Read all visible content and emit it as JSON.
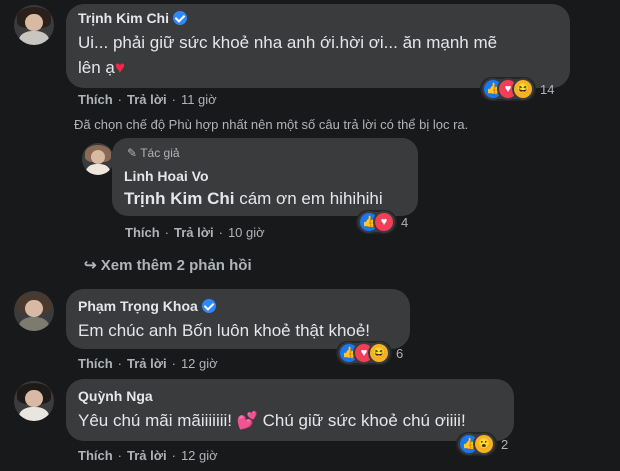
{
  "comments": [
    {
      "name": "Trịnh Kim Chi",
      "verified": true,
      "text_line1": "Ui... phải giữ sức khoẻ nha anh ới.hời ơi... ăn mạnh mẽ",
      "text_line2": "lên ạ",
      "text_emoji": "♥",
      "like_label": "Thích",
      "reply_label": "Trả lời",
      "time": "11 giờ",
      "reaction_icons": [
        "like-icon",
        "love-icon",
        "haha-icon"
      ],
      "reaction_count": "14"
    },
    {
      "name": "Phạm Trọng Khoa",
      "verified": true,
      "text_line1": "Em chúc anh Bốn luôn khoẻ thật khoẻ!",
      "like_label": "Thích",
      "reply_label": "Trả lời",
      "time": "12 giờ",
      "reaction_icons": [
        "like-icon",
        "love-icon",
        "haha-icon"
      ],
      "reaction_count": "6"
    },
    {
      "name": "Quỳnh Nga",
      "verified": false,
      "text_before": "Yêu chú mãi mãiiiiiii! ",
      "text_emoji": "💕",
      "text_after": " Chú giữ sức khoẻ chú ơiiii!",
      "like_label": "Thích",
      "reply_label": "Trả lời",
      "time": "12 giờ",
      "reaction_icons": [
        "like-icon",
        "wow-icon"
      ],
      "reaction_count": "2"
    }
  ],
  "filter_note": "Đã chọn chế độ Phù hợp nhất nên một số câu trả lời có thể bị lọc ra.",
  "reply": {
    "author_badge": "Tác giả",
    "name": "Linh Hoai Vo",
    "mention": "Trịnh Kim Chi",
    "text": " cám ơn em hihihihi",
    "like_label": "Thích",
    "reply_label": "Trả lời",
    "time": "10 giờ",
    "reaction_icons": [
      "like-icon",
      "love-icon"
    ],
    "reaction_count": "4"
  },
  "more_replies": "Xem thêm 2 phản hồi",
  "colors": {
    "background": "#18191a",
    "bubble": "#3a3b3c",
    "secondary_text": "#b0b3b8",
    "verified": "#2d88ff"
  }
}
